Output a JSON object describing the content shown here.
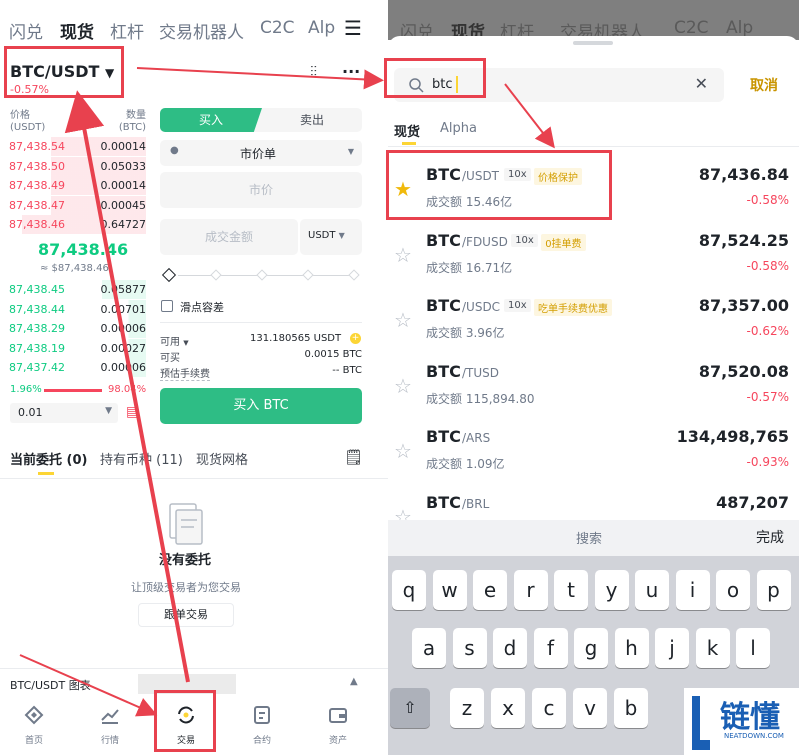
{
  "left": {
    "top_tabs": [
      "闪兑",
      "现货",
      "杠杆",
      "交易机器人",
      "C2C",
      "Alp"
    ],
    "pair": "BTC/USDT",
    "change": "-0.57%",
    "grid_icon": "⇅",
    "ob_header": {
      "price": "价格",
      "price_unit": "(USDT)",
      "qty": "数量",
      "qty_unit": "(BTC)"
    },
    "asks": [
      {
        "p": "87,438.54",
        "q": "0.00014"
      },
      {
        "p": "87,438.50",
        "q": "0.05033"
      },
      {
        "p": "87,438.49",
        "q": "0.00014"
      },
      {
        "p": "87,438.47",
        "q": "0.00045"
      },
      {
        "p": "87,438.46",
        "q": "0.64727"
      }
    ],
    "last_price": "87,438.46",
    "last_price_fiat": "≈ $87,438.46",
    "bids": [
      {
        "p": "87,438.45",
        "q": "0.05877"
      },
      {
        "p": "87,438.44",
        "q": "0.00701"
      },
      {
        "p": "87,438.29",
        "q": "0.00006"
      },
      {
        "p": "87,438.19",
        "q": "0.00027"
      },
      {
        "p": "87,437.42",
        "q": "0.00006"
      }
    ],
    "ratio_buy": "1.96%",
    "ratio_sell": "98.04%",
    "precision": "0.01",
    "buy_tab": "买入",
    "sell_tab": "卖出",
    "order_type": "市价单",
    "price_placeholder": "市价",
    "amount_placeholder": "成交金额",
    "amount_unit": "USDT",
    "slippage": "滑点容差",
    "available_label": "可用",
    "available_value": "131.180565 USDT",
    "can_buy_label": "可买",
    "can_buy_value": "0.0015 BTC",
    "fee_label": "预估手续费",
    "fee_value": "-- BTC",
    "buy_button": "买入 BTC",
    "order_tabs": [
      "当前委托 (0)",
      "持有币种 (11)",
      "现货网格"
    ],
    "empty_title": "没有委托",
    "empty_sub": "让顶级交易者为您交易",
    "copy_button": "跟单交易",
    "chart_bar": "BTC/USDT 图表",
    "nav": [
      "首页",
      "行情",
      "交易",
      "合约",
      "资产"
    ]
  },
  "right": {
    "ghost_tabs": [
      "闪兑",
      "现货",
      "杠杆",
      "交易机器人",
      "C2C",
      "Alp"
    ],
    "search_value": "btc",
    "cancel": "取消",
    "tabs": [
      "现货",
      "Alpha"
    ],
    "coins": [
      {
        "sym": "BTC",
        "quote": "/USDT",
        "lev": "10x",
        "tag": "价格保护",
        "vol": "成交额 15.46亿",
        "price": "87,436.84",
        "change": "-0.58%",
        "fav": true
      },
      {
        "sym": "BTC",
        "quote": "/FDUSD",
        "lev": "10x",
        "tag": "0挂单费",
        "vol": "成交额 16.71亿",
        "price": "87,524.25",
        "change": "-0.58%",
        "fav": false
      },
      {
        "sym": "BTC",
        "quote": "/USDC",
        "lev": "10x",
        "tag": "吃单手续费优惠",
        "vol": "成交额 3.96亿",
        "price": "87,357.00",
        "change": "-0.62%",
        "fav": false
      },
      {
        "sym": "BTC",
        "quote": "/TUSD",
        "lev": "",
        "tag": "",
        "vol": "成交额 115,894.80",
        "price": "87,520.08",
        "change": "-0.57%",
        "fav": false
      },
      {
        "sym": "BTC",
        "quote": "/ARS",
        "lev": "",
        "tag": "",
        "vol": "成交额 1.09亿",
        "price": "134,498,765",
        "change": "-0.93%",
        "fav": false
      },
      {
        "sym": "BTC",
        "quote": "/BRL",
        "lev": "",
        "tag": "",
        "vol": "",
        "price": "487,207",
        "change": "",
        "fav": false
      }
    ],
    "kb_search": "搜索",
    "kb_done": "完成",
    "row1": [
      "q",
      "w",
      "e",
      "r",
      "t",
      "y",
      "u",
      "i",
      "o",
      "p"
    ],
    "row2": [
      "a",
      "s",
      "d",
      "f",
      "g",
      "h",
      "j",
      "k",
      "l"
    ],
    "row3": [
      "z",
      "x",
      "c",
      "v",
      "b"
    ]
  },
  "watermark": {
    "text": "链懂",
    "sub": "NEATDOWN.COM"
  },
  "colors": {
    "green": "#0ecb81",
    "red": "#f6465d",
    "yellow": "#fcd535",
    "annotation": "#e8414e"
  }
}
